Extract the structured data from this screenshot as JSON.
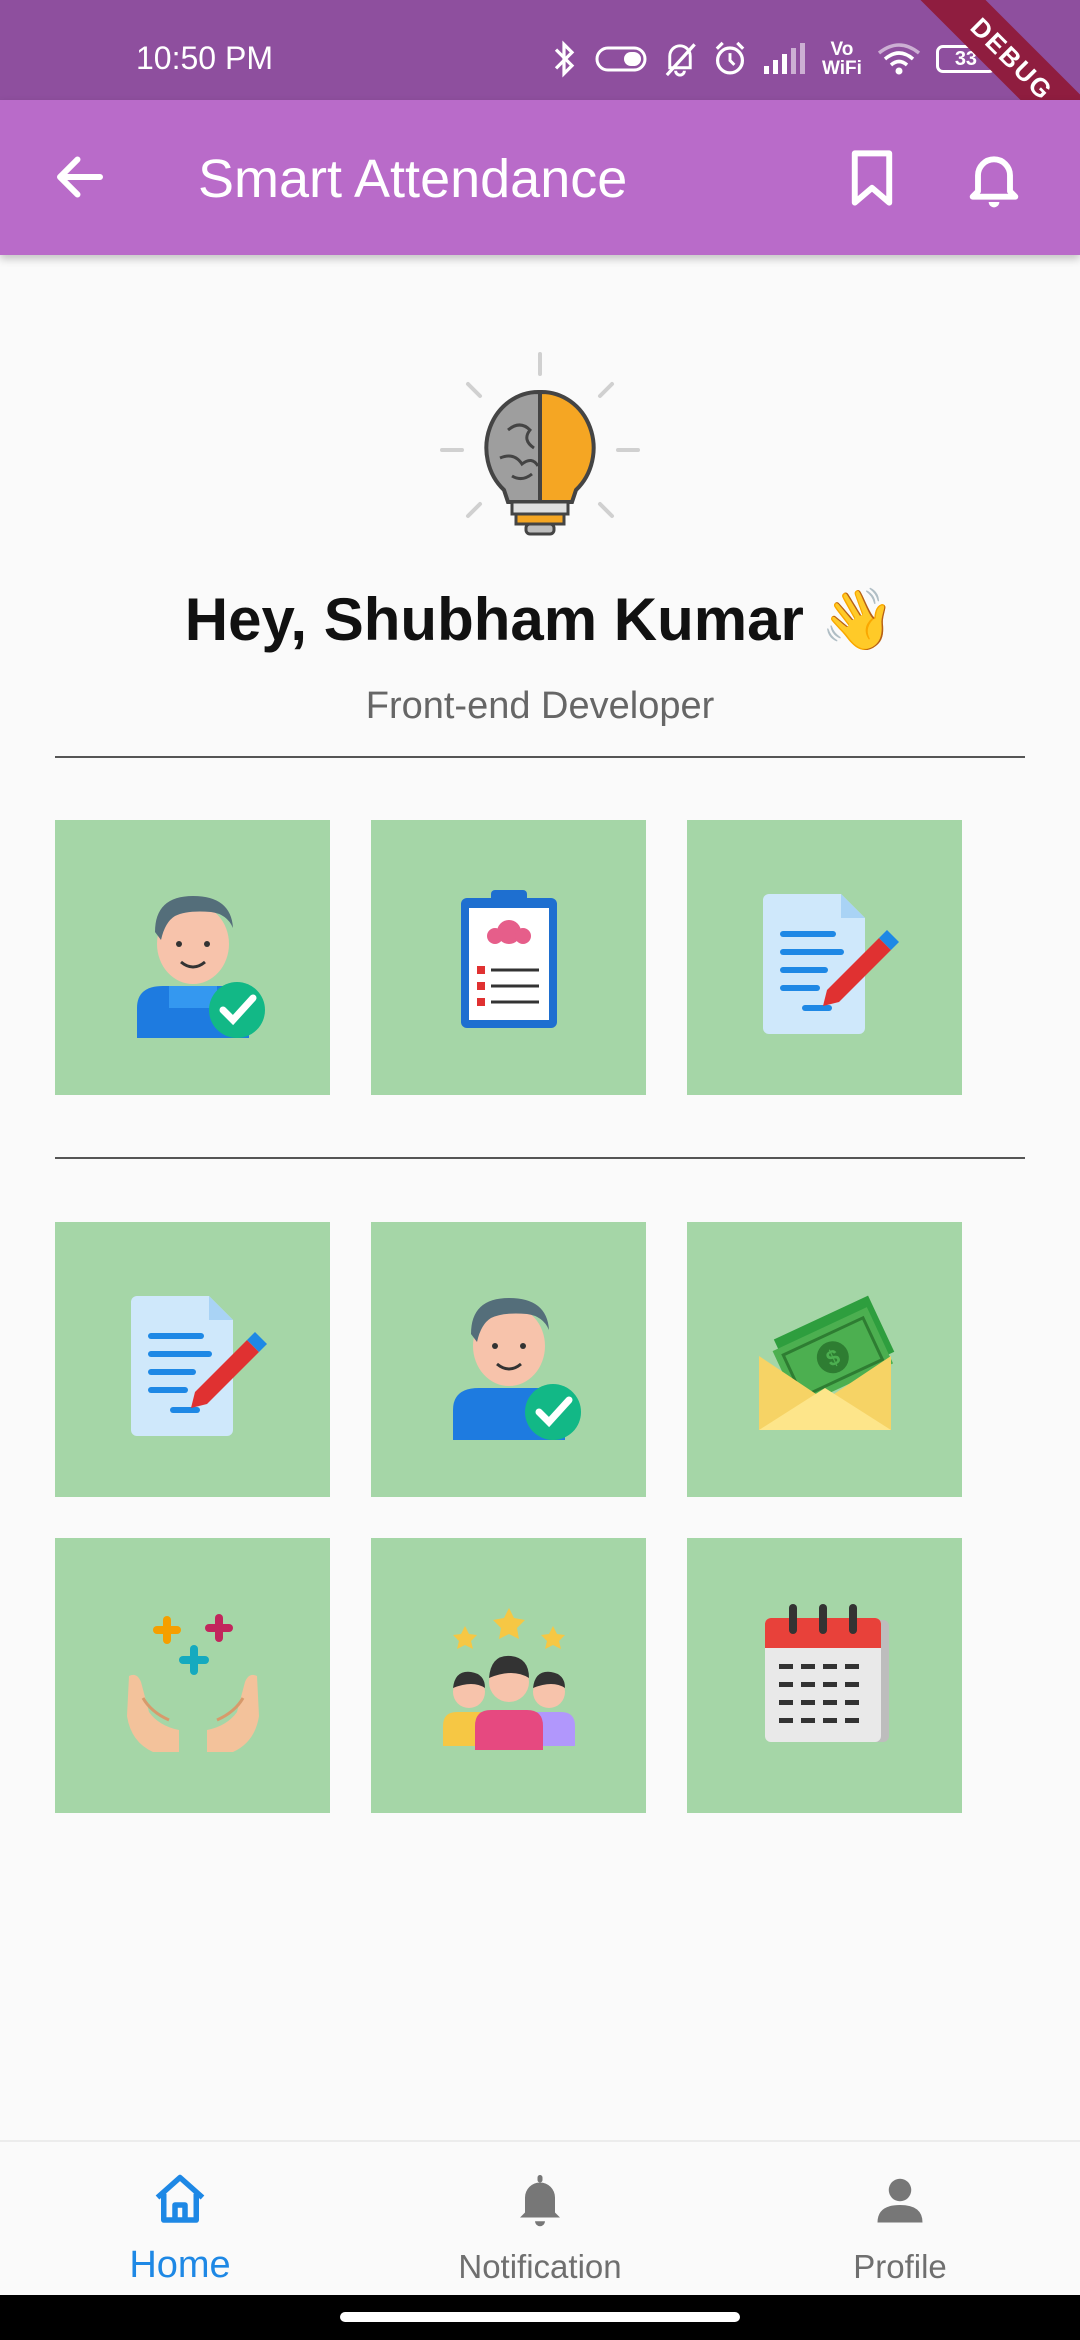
{
  "status_bar": {
    "time": "10:50 PM",
    "battery": "33",
    "debug_label": "DEBUG",
    "icons": [
      "bluetooth-icon",
      "vibrate-icon",
      "mute-icon",
      "alarm-icon",
      "signal-icon",
      "vowifi-icon",
      "wifi-icon",
      "battery-icon"
    ],
    "vowifi_line1": "Vo",
    "vowifi_line2": "WiFi"
  },
  "app_bar": {
    "title": "Smart Attendance",
    "back_icon": "arrow-left-icon",
    "bookmark_icon": "bookmark-icon",
    "notification_icon": "bell-icon",
    "background": "#b96bc9"
  },
  "profile": {
    "greeting": "Hey, Shubham Kumar 👋",
    "role": "Front-end Developer",
    "hero_icon": "brain-lightbulb-icon"
  },
  "tiles": {
    "background": "#a5d6a7",
    "row1": [
      "mark-attendance-icon",
      "attendance-list-icon",
      "document-edit-icon"
    ],
    "row2": [
      "document-edit-icon",
      "user-verified-icon",
      "salary-envelope-icon"
    ],
    "row3": [
      "math-hands-icon",
      "team-stars-icon",
      "calendar-icon"
    ]
  },
  "bottom_nav": {
    "items": [
      {
        "label": "Home",
        "icon": "home-icon",
        "active": true
      },
      {
        "label": "Notification",
        "icon": "bell-icon",
        "active": false
      },
      {
        "label": "Profile",
        "icon": "person-icon",
        "active": false
      }
    ],
    "active_color": "#1e88e5"
  }
}
